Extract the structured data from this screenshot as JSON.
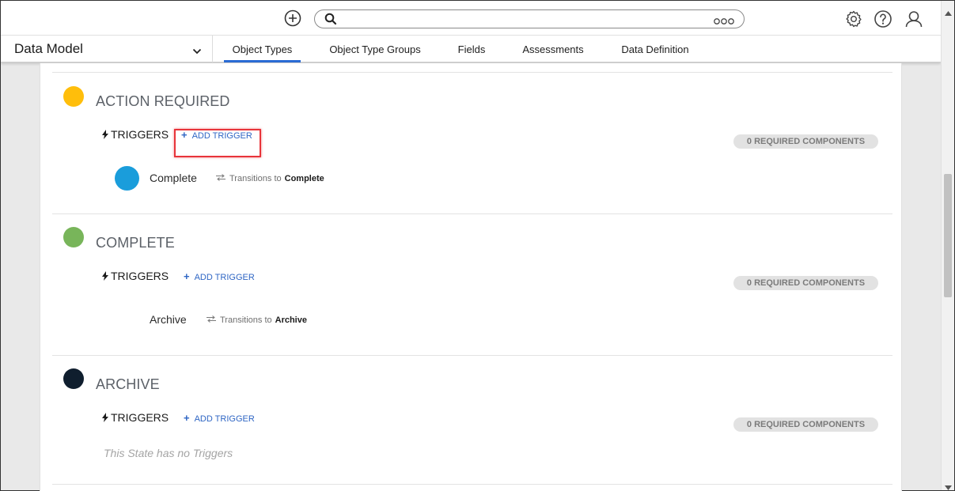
{
  "colors": {
    "accent": "#2a6bd4",
    "link": "#2f66c4",
    "highlight": "#e8343a",
    "action_required": "#ffbe0b",
    "complete": "#78b55a",
    "archive": "#0f1e2e",
    "trigger_complete": "#1a9ddb"
  },
  "header": {
    "search": {
      "value": "",
      "placeholder": ""
    }
  },
  "nav": {
    "module": "Data Model",
    "tabs": [
      {
        "label": "Object Types",
        "active": true
      },
      {
        "label": "Object Type Groups",
        "active": false
      },
      {
        "label": "Fields",
        "active": false
      },
      {
        "label": "Assessments",
        "active": false
      },
      {
        "label": "Data Definition",
        "active": false
      }
    ]
  },
  "states": [
    {
      "title": "ACTION REQUIRED",
      "triggers_label": "TRIGGERS",
      "add_trigger": "ADD TRIGGER",
      "required": "0 REQUIRED COMPONENTS",
      "triggers": [
        {
          "name": "Complete",
          "transitions_label": "Transitions to",
          "target": "Complete"
        }
      ]
    },
    {
      "title": "COMPLETE",
      "triggers_label": "TRIGGERS",
      "add_trigger": "ADD TRIGGER",
      "required": "0 REQUIRED COMPONENTS",
      "triggers": [
        {
          "name": "Archive",
          "transitions_label": "Transitions to",
          "target": "Archive"
        }
      ]
    },
    {
      "title": "ARCHIVE",
      "triggers_label": "TRIGGERS",
      "add_trigger": "ADD TRIGGER",
      "required": "0 REQUIRED COMPONENTS",
      "empty_text": "This State has no Triggers"
    }
  ]
}
